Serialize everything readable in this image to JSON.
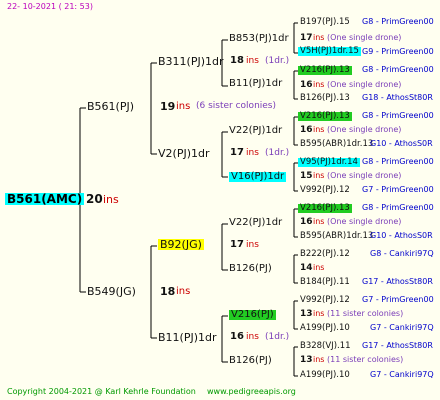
{
  "date": "22- 10-2021 ( 21: 53)",
  "footer": {
    "copyright": "Copyright 2004-2021 @ Karl Kehrle Foundation",
    "url": "www.pedigreeapis.org"
  },
  "colors": {
    "yellow": "#ffff00",
    "cyan": "#00ffff",
    "green": "#22cc22",
    "red": "#cc0000",
    "blue": "#0000cc",
    "purple": "#7a3db8",
    "bg": "#fffff0",
    "line": "#000000"
  },
  "root": {
    "name": "B561(AMC)",
    "ins": "20",
    "unit": "ins"
  },
  "g1": [
    {
      "name": "B561(PJ)",
      "ins": "19",
      "unit": "ins",
      "note": "(6 sister colonies)"
    },
    {
      "name": "B549(JG)",
      "ins": "18",
      "unit": "ins"
    }
  ],
  "g2": [
    {
      "name": "B311(PJ)1dr",
      "ins": "18",
      "unit": "ins",
      "note": "(1dr.)"
    },
    {
      "name": "V2(PJ)1dr",
      "ins": "17",
      "unit": "ins",
      "note": "(1dr.)"
    },
    {
      "name": "B92(JG)",
      "ins": "17",
      "unit": "ins"
    },
    {
      "name": "B11(PJ)1dr",
      "ins": "16",
      "unit": "ins",
      "note": "(1dr.)"
    }
  ],
  "g3": [
    {
      "name": "B853(PJ)1dr",
      "ins": "17",
      "unit": "ins",
      "note": "(One single drone)"
    },
    {
      "name": "B11(PJ)1dr",
      "ins": "16",
      "unit": "ins",
      "note": "(One single drone)"
    },
    {
      "name": "V22(PJ)1dr",
      "ins": "16",
      "unit": "ins",
      "note": "(One single drone)"
    },
    {
      "name": "V16(PJ)1dr",
      "ins": "15",
      "unit": "ins",
      "note": "(One single drone)"
    },
    {
      "name": "V22(PJ)1dr",
      "ins": "16",
      "unit": "ins",
      "note": "(One single drone)"
    },
    {
      "name": "B126(PJ)",
      "ins": "14",
      "unit": "ins"
    },
    {
      "name": "V216(PJ)",
      "ins": "13",
      "unit": "ins",
      "note": "(11 sister colonies)"
    },
    {
      "name": "B126(PJ)",
      "ins": "13",
      "unit": "ins",
      "note": "(11 sister colonies)"
    }
  ],
  "g4": [
    {
      "name": "B197(PJ).15",
      "line": "G8 - PrimGreen00"
    },
    {
      "name": "V5H(PJ)1dr.15",
      "line": "G9 - PrimGreen00"
    },
    {
      "name": "V216(PJ).13",
      "line": "G8 - PrimGreen00"
    },
    {
      "name": "B126(PJ).13",
      "line": "G18 - AthosSt80R"
    },
    {
      "name": "V216(PJ).13",
      "line": "G8 - PrimGreen00"
    },
    {
      "name": "B595(ABR)1dr.13",
      "line": "G10 - AthosS0R"
    },
    {
      "name": "V95(PJ)1dr.14",
      "line": "G8 - PrimGreen00"
    },
    {
      "name": "V992(PJ).12",
      "line": "G7 - PrimGreen00"
    },
    {
      "name": "V216(PJ).13",
      "line": "G8 - PrimGreen00"
    },
    {
      "name": "B595(ABR)1dr.13",
      "line": "G10 - AthosS0R"
    },
    {
      "name": "B222(PJ).12",
      "line": "G8 - Cankiri97Q"
    },
    {
      "name": "B184(PJ).11",
      "line": "G17 - AthosSt80R"
    },
    {
      "name": "V992(PJ).12",
      "line": "G7 - PrimGreen00"
    },
    {
      "name": "A199(PJ).10",
      "line": "G7 - Cankiri97Q"
    },
    {
      "name": "B328(VJ).11",
      "line": "G17 - AthosSt80R"
    },
    {
      "name": "A199(PJ).10",
      "line": "G7 - Cankiri97Q"
    }
  ]
}
